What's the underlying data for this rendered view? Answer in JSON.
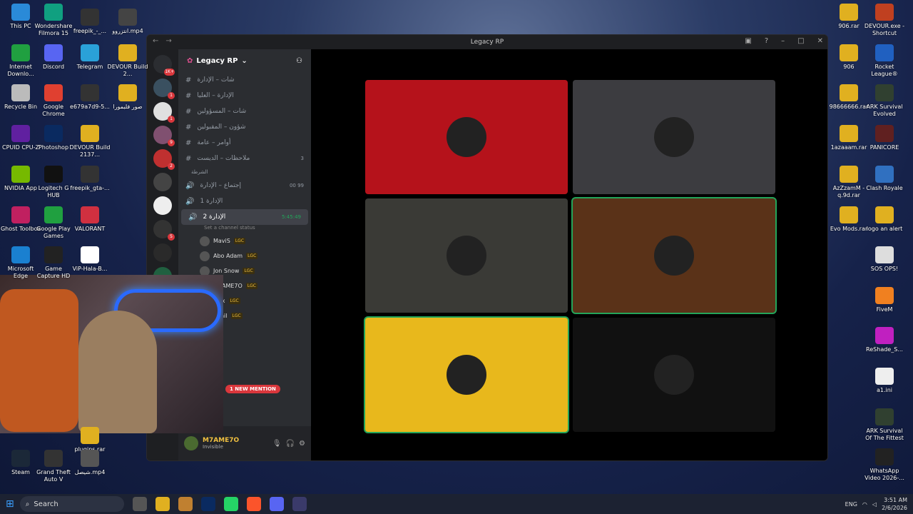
{
  "desktop_left": [
    {
      "label": "This PC",
      "color": "#2a8ad8"
    },
    {
      "label": "Wondershare Filmora 15",
      "color": "#10a080"
    },
    {
      "label": "freepik_-_...",
      "color": "#333"
    },
    {
      "label": "انتزروو.mp4",
      "color": "#444"
    },
    {
      "label": "Internet Downlo...",
      "color": "#20a040"
    },
    {
      "label": "Discord",
      "color": "#5865f2"
    },
    {
      "label": "Telegram",
      "color": "#2aa1d8"
    },
    {
      "label": "DEVOUR Build 2...",
      "color": "#e0b020"
    },
    {
      "label": "Recycle Bin",
      "color": "#bbb"
    },
    {
      "label": "Google Chrome",
      "color": "#e04030"
    },
    {
      "label": "e679a7d9-5...",
      "color": "#333"
    },
    {
      "label": "صور فلبمورا",
      "color": "#e0b020"
    },
    {
      "label": "CPUID CPU-Z",
      "color": "#6020a0"
    },
    {
      "label": "Photoshop",
      "color": "#0a2a60"
    },
    {
      "label": "DEVOUR Build 2137...",
      "color": "#e0b020"
    },
    {
      "label": "NVIDIA App",
      "color": "#76b900"
    },
    {
      "label": "Logitech G HUB",
      "color": "#111"
    },
    {
      "label": "freepik_gta-...",
      "color": "#333"
    },
    {
      "label": "Ghost Toolbox",
      "color": "#c02060"
    },
    {
      "label": "Google Play Games",
      "color": "#20a040"
    },
    {
      "label": "VALORANT",
      "color": "#d03040"
    },
    {
      "label": "Microsoft Edge",
      "color": "#1a80d0"
    },
    {
      "label": "Game Capture HD",
      "color": "#222"
    },
    {
      "label": "ViP-Hala-B...",
      "color": "#fff"
    },
    {
      "label": "plugins.rar",
      "color": "#e0b020"
    },
    {
      "label": "Steam",
      "color": "#1b2838"
    },
    {
      "label": "Grand Theft Auto V",
      "color": "#333"
    },
    {
      "label": "شيصل.mp4",
      "color": "#555"
    }
  ],
  "desktop_right": [
    {
      "label": "906.rar",
      "color": "#e0b020"
    },
    {
      "label": "DEVOUR.exe - Shortcut",
      "color": "#c04020"
    },
    {
      "label": "906",
      "color": "#e0b020"
    },
    {
      "label": "Rocket League®",
      "color": "#2060c0"
    },
    {
      "label": "98666666.rar",
      "color": "#e0b020"
    },
    {
      "label": "ARK Survival Evolved",
      "color": "#304030"
    },
    {
      "label": "1azaaam.rar",
      "color": "#e0b020"
    },
    {
      "label": "PANICORE",
      "color": "#602020"
    },
    {
      "label": "AzZzamM - q.9d.rar",
      "color": "#e0b020"
    },
    {
      "label": "Clash Royale",
      "color": "#3070c0"
    },
    {
      "label": "Evo Mods.rar",
      "color": "#e0b020"
    },
    {
      "label": "logo an alert",
      "color": "#e0b020"
    },
    {
      "label": "SOS OPS!",
      "color": "#ddd"
    },
    {
      "label": "FiveM",
      "color": "#f08020"
    },
    {
      "label": "ReShade_S...",
      "color": "#c020c0"
    },
    {
      "label": "a1.ini",
      "color": "#eee"
    },
    {
      "label": "ARK Survival Of The Fittest",
      "color": "#304030"
    },
    {
      "label": "WhatsApp Video 2026-...",
      "color": "#222"
    }
  ],
  "window": {
    "title": "Legacy RP"
  },
  "guild": {
    "name": "Legacy RP"
  },
  "channels": [
    {
      "name": "شات – الإدارة",
      "type": "text"
    },
    {
      "name": "الإدارة – العليا",
      "type": "text"
    },
    {
      "name": "شات – المسؤولين",
      "type": "text"
    },
    {
      "name": "شؤون – المقبولين",
      "type": "text"
    },
    {
      "name": "أوامر – عامة",
      "type": "text"
    },
    {
      "name": "ملاحظات – الديست",
      "type": "text",
      "count": "3"
    },
    {
      "name": "الشرطة",
      "type": "category"
    },
    {
      "name": "إجتماع – الإدارة",
      "type": "voice",
      "count": "00 99"
    },
    {
      "name": "الإدارة 1",
      "type": "voice"
    },
    {
      "name": "الإدارة 2",
      "type": "voice",
      "active": true,
      "timer": "5:45:49",
      "status": "Set a channel status"
    }
  ],
  "voice_users": [
    {
      "name": "MaviS",
      "tag": "LGC"
    },
    {
      "name": "Abo Adam",
      "tag": "LGC"
    },
    {
      "name": "Jon Snow",
      "tag": "LGC"
    },
    {
      "name": "M7AME7O",
      "tag": "LGC"
    },
    {
      "name": "Max",
      "tag": "LGC"
    },
    {
      "name": "Sohil",
      "tag": "LGC"
    }
  ],
  "mention": "1 NEW MENTION",
  "user": {
    "name": "M7AME7O",
    "status": "Invisible"
  },
  "servers": [
    {
      "badge": "1K+"
    },
    {
      "badge": "1"
    },
    {
      "badge": "1"
    },
    {
      "badge": "9"
    },
    {
      "badge": "2"
    },
    {
      "badge": ""
    },
    {
      "badge": ""
    },
    {
      "badge": "5"
    },
    {
      "badge": ""
    },
    {
      "badge": "204"
    }
  ],
  "tiles": [
    {
      "bg": "#b5121b"
    },
    {
      "bg": "#3c3c40"
    },
    {
      "bg": "#3a3a36"
    },
    {
      "bg": "#5a3218",
      "speaking": true
    },
    {
      "bg": "#e8b81c",
      "speaking": true
    },
    {
      "bg": "#111"
    }
  ],
  "taskbar": {
    "search": "Search",
    "time": "3:51 AM",
    "date": "2/6/2026",
    "lang": "ENG"
  }
}
